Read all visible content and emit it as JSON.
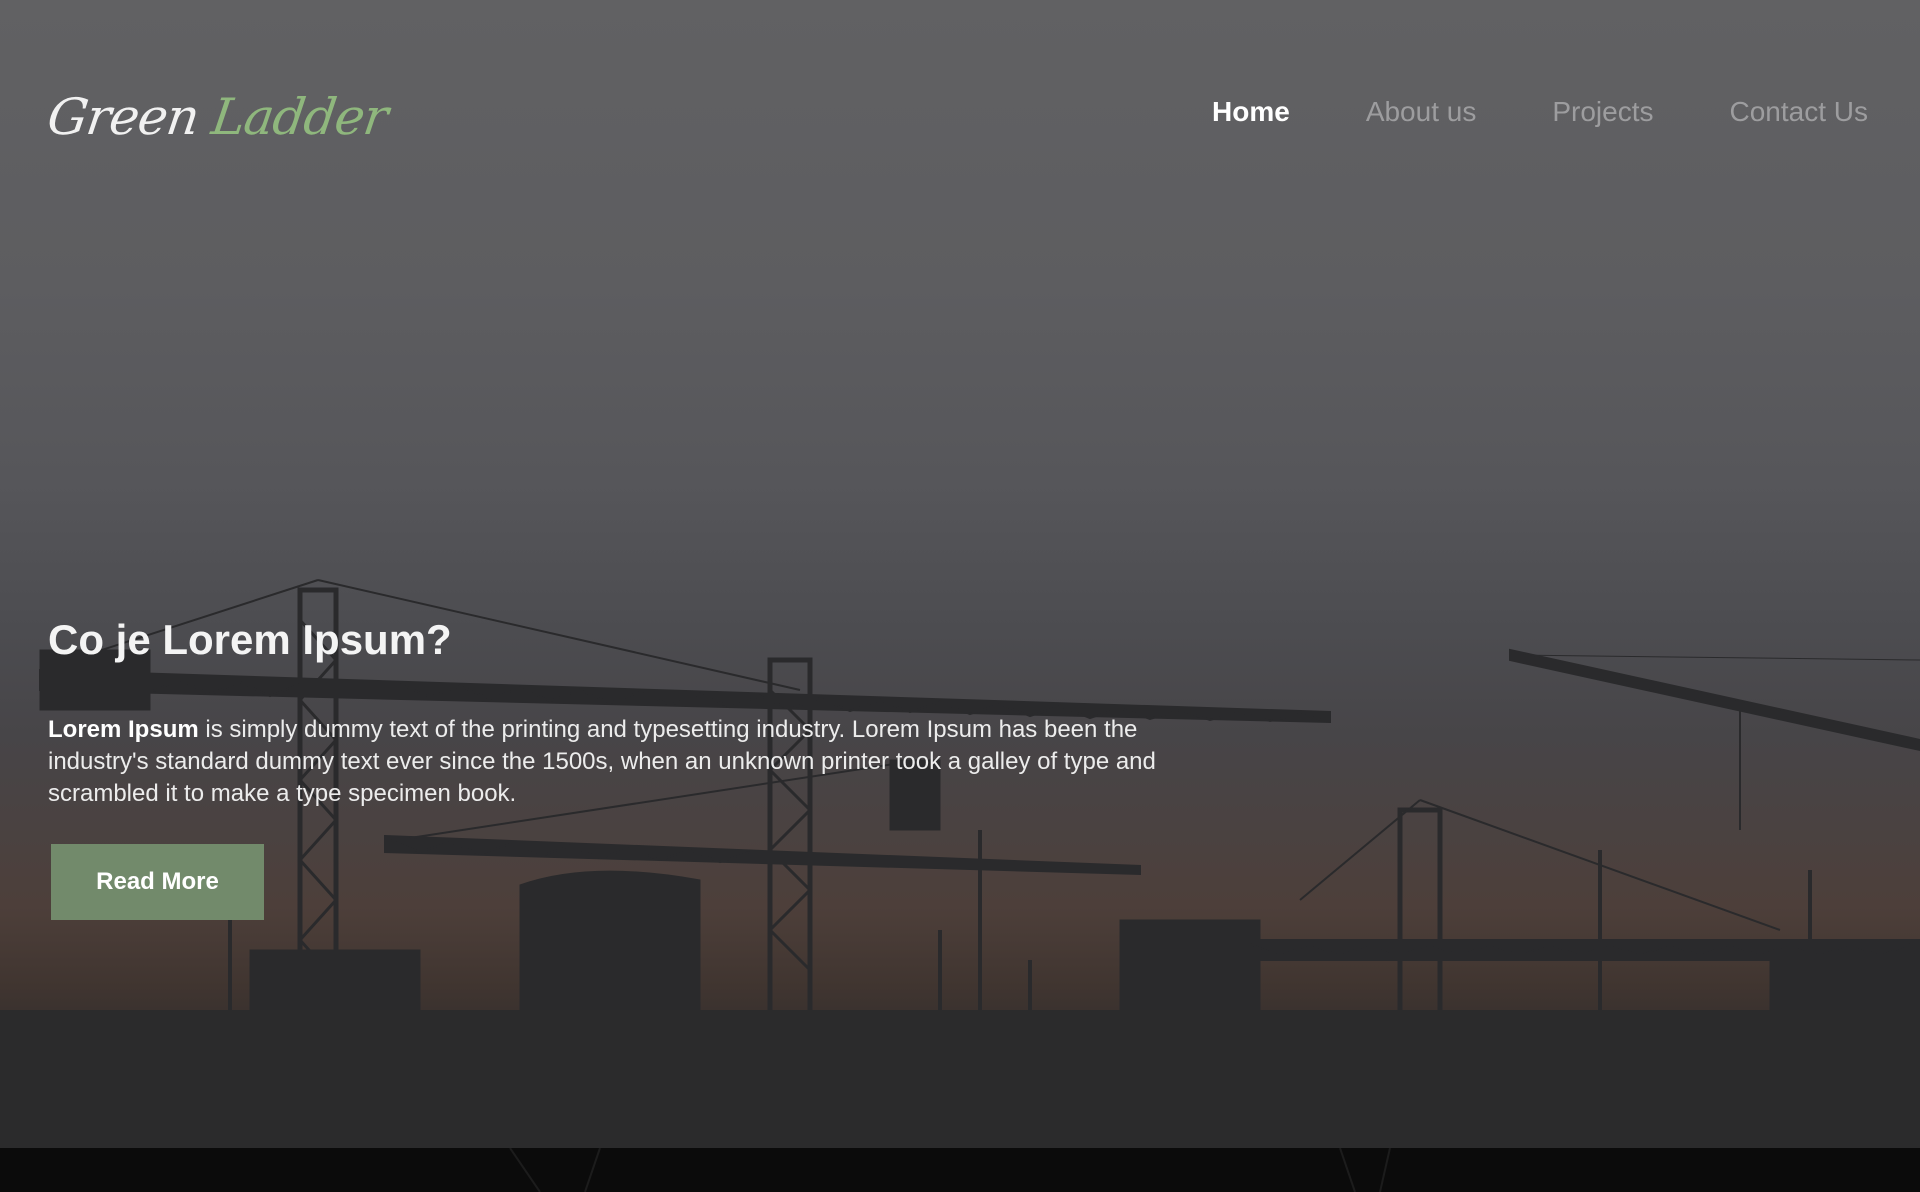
{
  "header": {
    "logo_word_1": "Green",
    "logo_word_2": "Ladder",
    "nav": [
      {
        "label": "Home",
        "active": true
      },
      {
        "label": "About us",
        "active": false
      },
      {
        "label": "Projects",
        "active": false
      },
      {
        "label": "Contact Us",
        "active": false
      }
    ]
  },
  "hero": {
    "title": "Co je Lorem Ipsum?",
    "text_bold": "Lorem Ipsum",
    "text_rest": " is simply dummy text of the printing and typesetting industry. Lorem Ipsum has been the industry's standard dummy text ever since the 1500s, when an unknown printer took a galley of type and scrambled it to make a type specimen book.",
    "button_label": "Read More"
  },
  "colors": {
    "accent_green": "#8fb77d",
    "button_green": "#728a6b",
    "nav_inactive": "#9d9d9f",
    "nav_active": "#ffffff"
  },
  "icons": {
    "background": "construction-cranes-silhouette"
  }
}
